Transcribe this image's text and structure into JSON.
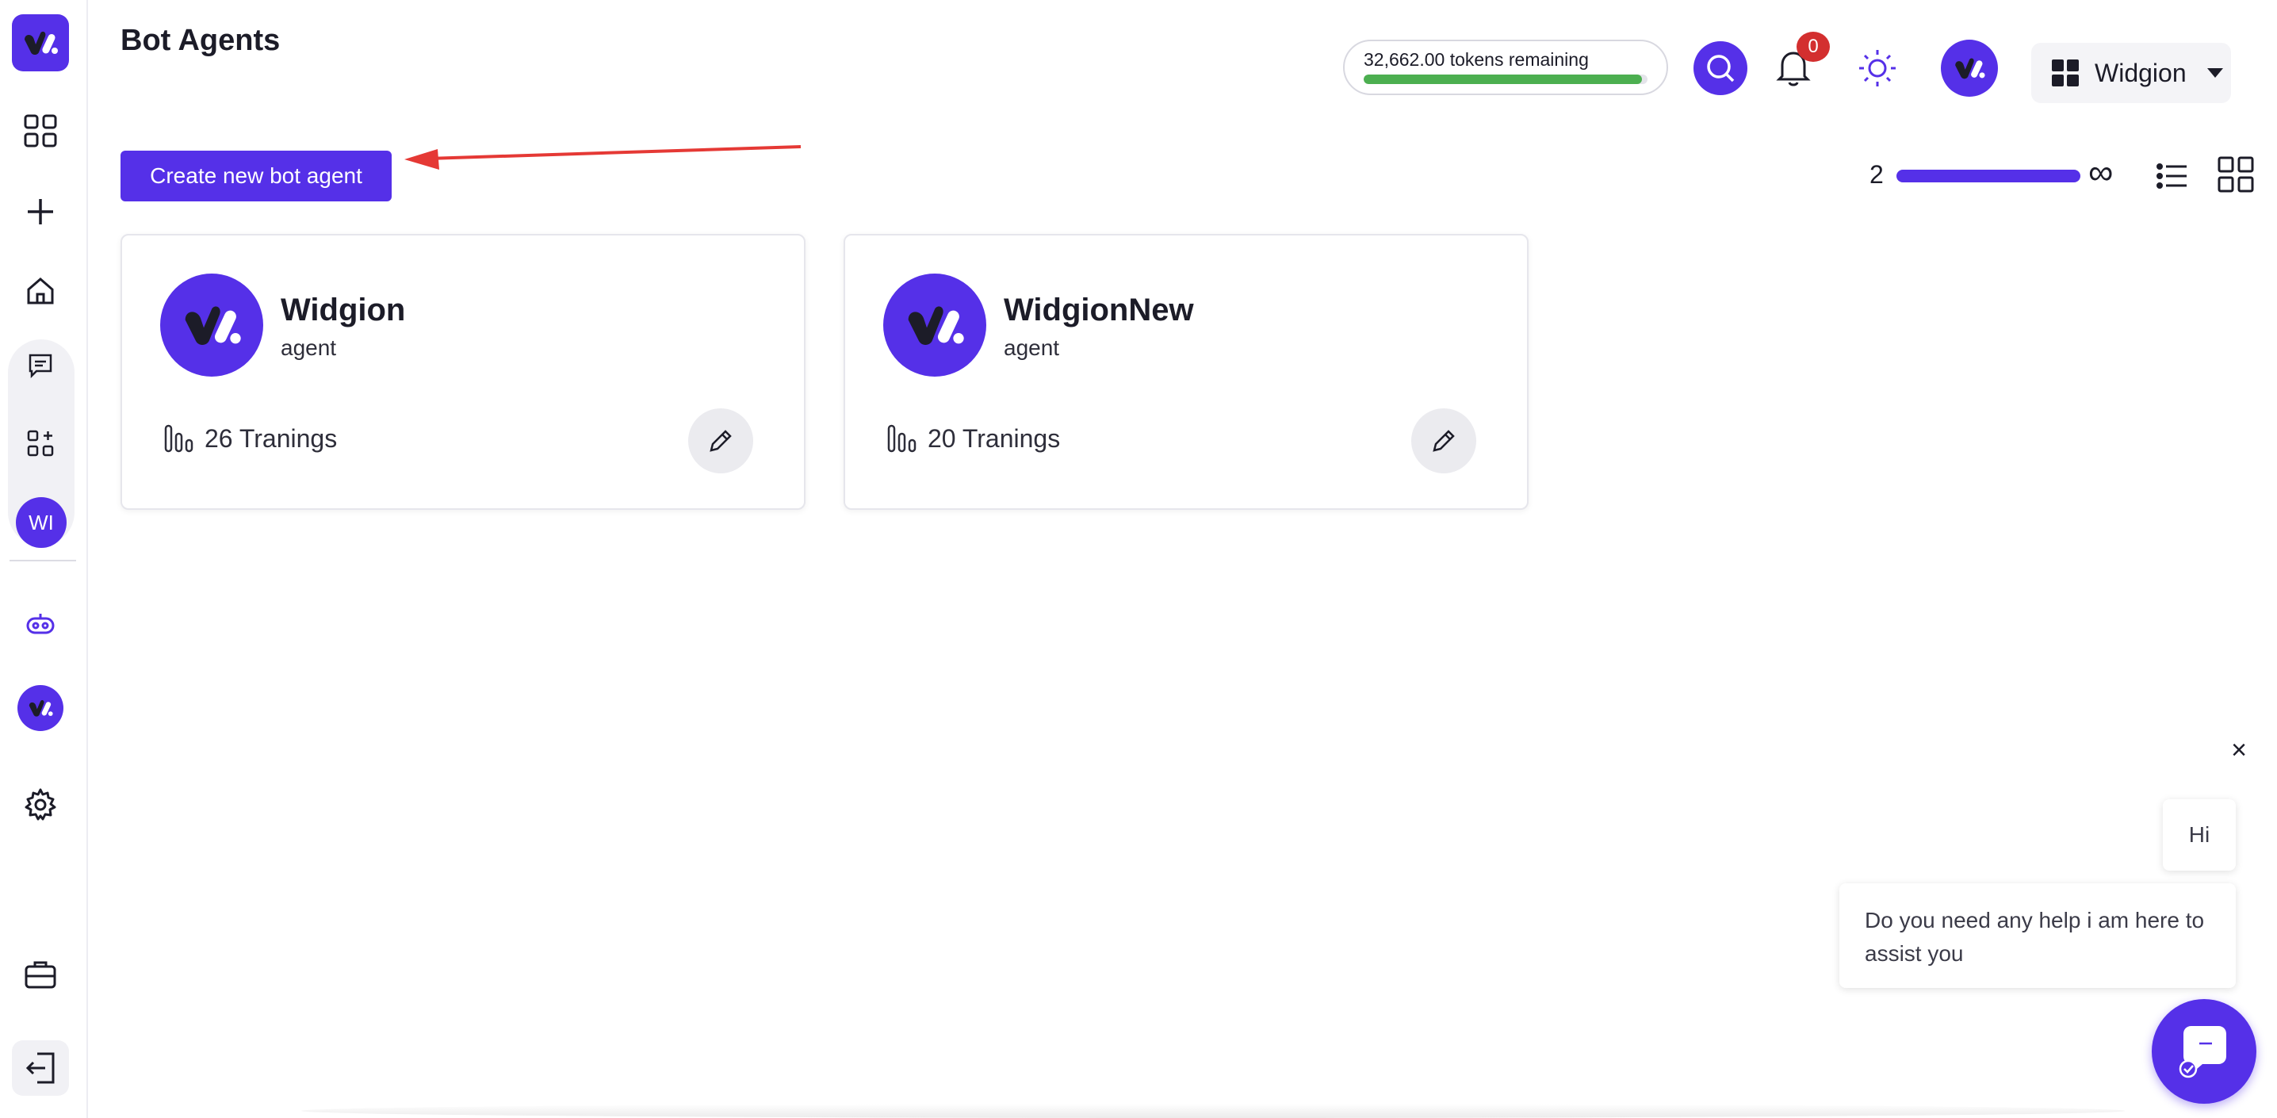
{
  "header": {
    "title": "Bot Agents",
    "tokens_text": "32,662.00 tokens remaining",
    "tokens_fraction": 0.98,
    "notification_count": "0",
    "workspace_name": "Widgion"
  },
  "sidebar": {
    "avatar_initials": "WI"
  },
  "toolbar": {
    "create_label": "Create new bot agent",
    "page_count": "2",
    "infinity_symbol": "∞"
  },
  "agents": [
    {
      "name": "Widgion",
      "type": "agent",
      "trainings": "26 Tranings"
    },
    {
      "name": "WidgionNew",
      "type": "agent",
      "trainings": "20 Tranings"
    }
  ],
  "chat": {
    "close_symbol": "×",
    "greeting": "Hi",
    "help_message": "Do you need any help i am here to assist you"
  },
  "colors": {
    "brand": "#5530e8",
    "tokens_bar": "#4caf50",
    "badge": "#d32f2f",
    "annotation_arrow": "#e53935"
  },
  "icons": [
    "brand-logo-icon",
    "dashboard-icon",
    "plus-icon",
    "home-icon",
    "chat-icon",
    "apps-add-icon",
    "robot-icon",
    "settings-icon",
    "briefcase-icon",
    "logout-icon",
    "search-icon",
    "bell-icon",
    "sun-icon",
    "grid-icon",
    "list-view-icon",
    "grid-view-icon",
    "bar-chart-icon",
    "pencil-icon",
    "chat-bubble-icon"
  ]
}
